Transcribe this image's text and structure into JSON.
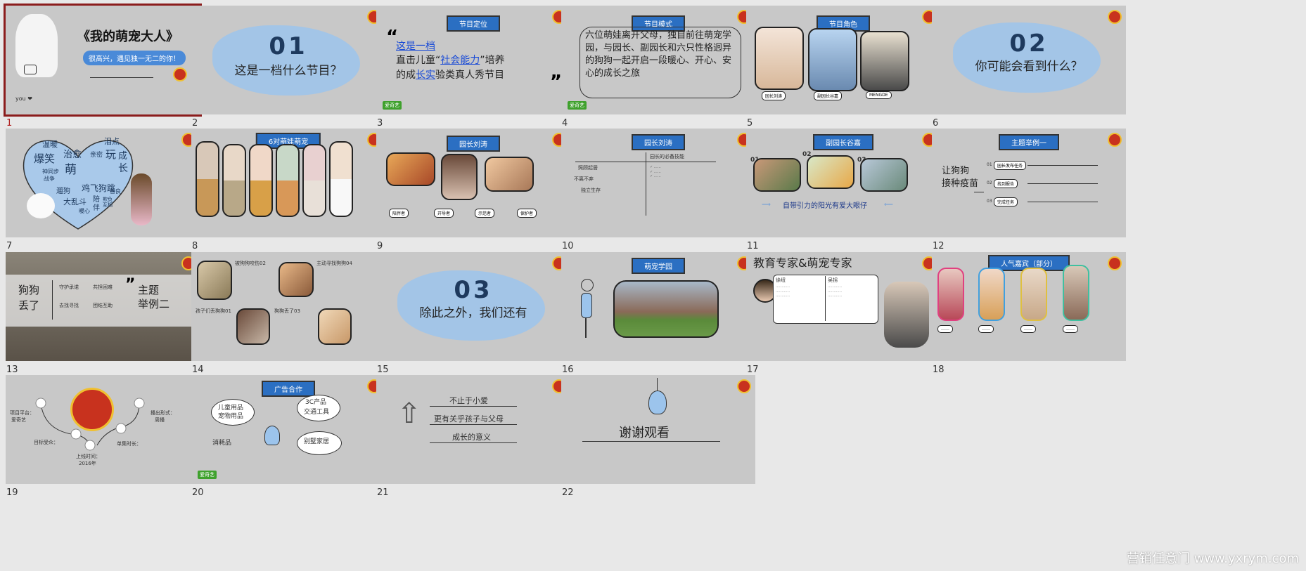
{
  "slides": [
    {
      "num": "1",
      "title": "《我的萌宠大人》",
      "subtitle": "很高兴，遇见独一无二的你！",
      "sign": "you ❤"
    },
    {
      "num": "2",
      "big": "01",
      "text": "这是一档什么节目？"
    },
    {
      "num": "3",
      "banner": "节目定位",
      "line1": "这是一档",
      "line2a": "直击儿童“",
      "line2b": "社会能力",
      "line2c": "”培养",
      "line3a": "的成",
      "line3b": "长实",
      "line3c": "验类真人秀节目"
    },
    {
      "num": "4",
      "banner": "节目模式",
      "body": "六位萌娃离开父母，独自前往萌宠学园，与园长、副园长和六只性格迥异的狗狗一起开启一段暖心、开心、安心的成长之旅"
    },
    {
      "num": "5",
      "banner": "节目角色",
      "labels": [
        "园长刘涛",
        "副园长谷嘉",
        "MENGDE"
      ]
    },
    {
      "num": "6",
      "big": "02",
      "text": "你可能会看到什么？"
    },
    {
      "num": "7",
      "words": [
        "温暖",
        "泪点",
        "爆笑",
        "治愈",
        "亲密",
        "玩",
        "成",
        "神同步",
        "萌",
        "长",
        "战争",
        "遛狗",
        "鸡飞狗跳",
        "大乱斗",
        "陪",
        "伴",
        "欺负",
        "互相",
        "善良",
        "暖心"
      ]
    },
    {
      "num": "8",
      "banner": "6对萌娃萌宠"
    },
    {
      "num": "9",
      "banner": "园长刘涛",
      "labels": [
        "陪伴者",
        "开导者",
        "示范者",
        "保护者"
      ]
    },
    {
      "num": "10",
      "banner": "园长刘涛",
      "heading": "园长的必备技能",
      "rows": [
        "照顾起居",
        "不离不弃",
        "独立生存"
      ]
    },
    {
      "num": "11",
      "banner": "副园长谷嘉",
      "marks": [
        "01",
        "02",
        "03"
      ],
      "caption": "自带引力的阳光有爱大眼仔"
    },
    {
      "num": "12",
      "banner": "主题举例一",
      "left1": "让狗狗",
      "left2": "接种疫苗",
      "items": [
        {
          "n": "01",
          "label": "园长发布任务"
        },
        {
          "n": "02",
          "label": "找到报告"
        },
        {
          "n": "03",
          "label": "完成任务"
        }
      ]
    },
    {
      "num": "13",
      "left": "狗狗丢了",
      "right1": "主题",
      "right2": "举例二",
      "tags": [
        "守护承诺",
        "共担困难",
        "去找寻找",
        "团结互助"
      ]
    },
    {
      "num": "14",
      "heads": [
        {
          "t": "被狗狗咬伤02"
        },
        {
          "t": "主动寻找狗狗04"
        },
        {
          "t": "孩子们丢狗狗01"
        },
        {
          "t": "狗狗丢了03"
        }
      ]
    },
    {
      "num": "15",
      "big": "03",
      "text": "除此之外，我们还有"
    },
    {
      "num": "16",
      "banner": "萌宠学园"
    },
    {
      "num": "17",
      "title": "教育专家&萌宠专家",
      "left": "徐纽",
      "right": "吴拐"
    },
    {
      "num": "18",
      "banner": "人气嘉宾（部分）"
    },
    {
      "num": "19",
      "left1": "项目平台：",
      "left1b": "爱奇艺",
      "right1": "播出形式：",
      "right1b": "周播",
      "bl": "目标受众：",
      "bm": "上线时间：",
      "bmb": "2016年",
      "br": "单集时长："
    },
    {
      "num": "20",
      "banner": "广告合作",
      "items": [
        "儿童用品",
        "宠物用品",
        "3C产品",
        "交通工具",
        "消耗品",
        "别墅家居"
      ]
    },
    {
      "num": "21",
      "lines": [
        "不止于小爱",
        "更有关乎孩子与父母",
        "成长的意义"
      ]
    },
    {
      "num": "22",
      "text": "谢谢观看"
    }
  ],
  "watermark": "营销任意门 www.yxrym.com",
  "brand": "爱奇艺"
}
